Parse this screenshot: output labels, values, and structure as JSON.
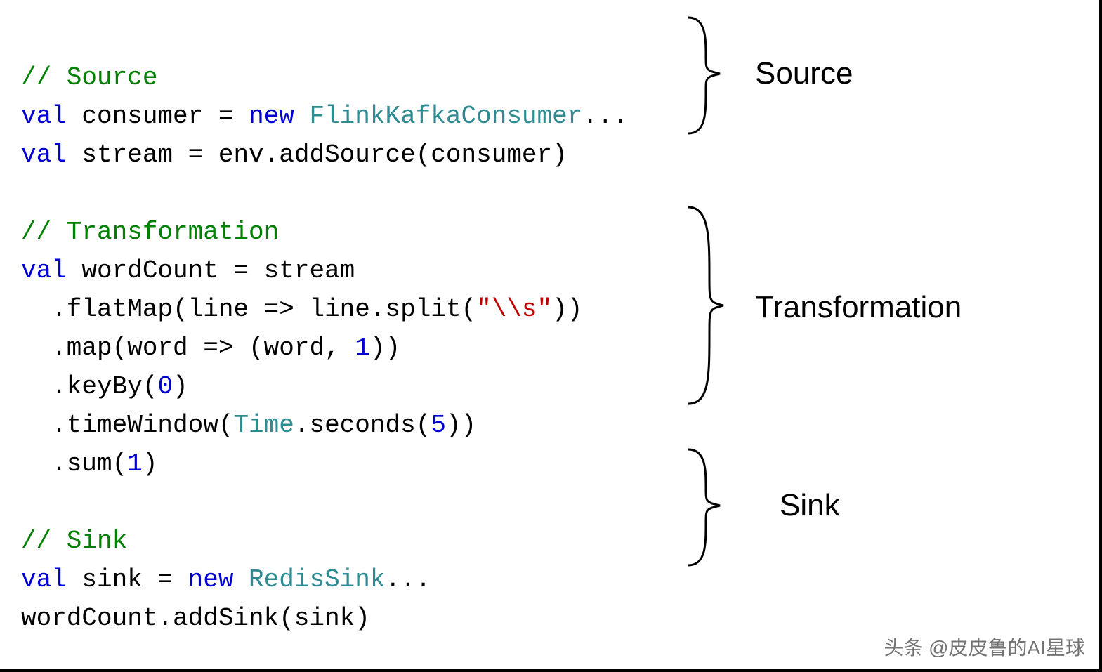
{
  "code": {
    "l1_comment": "// Source",
    "l2_val": "val",
    "l2_consumer": " consumer = ",
    "l2_new": "new",
    "l2_type": " FlinkKafkaConsumer",
    "l2_rest": "...",
    "l3_val": "val",
    "l3_rest": " stream = env.addSource(consumer)",
    "l5_comment": "// Transformation",
    "l6_val": "val",
    "l6_rest": " wordCount = stream",
    "l7_a": "  .flatMap(line => line.split(",
    "l7_str": "\"\\\\s\"",
    "l7_b": "))",
    "l8_a": "  .map(word => (word, ",
    "l8_num": "1",
    "l8_b": "))",
    "l9_a": "  .keyBy(",
    "l9_num": "0",
    "l9_b": ")",
    "l10_a": "  .timeWindow(",
    "l10_type": "Time",
    "l10_b": ".seconds(",
    "l10_num": "5",
    "l10_c": "))",
    "l11_a": "  .sum(",
    "l11_num": "1",
    "l11_b": ")",
    "l13_comment": "// Sink",
    "l14_val": "val",
    "l14_a": " sink = ",
    "l14_new": "new",
    "l14_type": " RedisSink",
    "l14_rest": "...",
    "l15": "wordCount.addSink(sink)"
  },
  "labels": {
    "source": "Source",
    "transformation": "Transformation",
    "sink": "Sink"
  },
  "watermark": "头条 @皮皮鲁的AI星球"
}
